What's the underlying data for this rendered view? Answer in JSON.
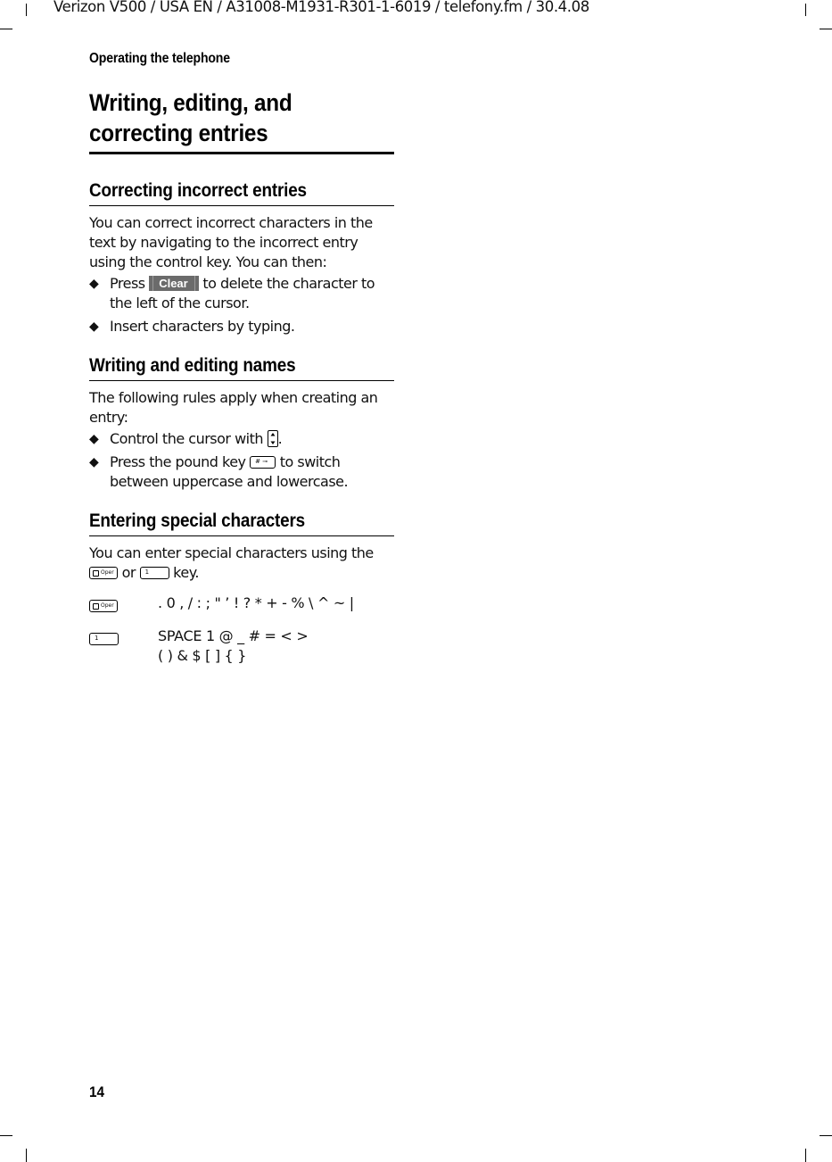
{
  "print_header": "Verizon V500 / USA EN / A31008-M1931-R301-1-6019 / telefony.fm / 30.4.08",
  "running_head": "Operating the telephone",
  "title": "Writing, editing, and correcting entries",
  "sections": [
    {
      "heading": "Correcting incorrect entries",
      "intro": "You can correct incorrect characters in the text by navigating to the incorrect entry using the control key. You can then:",
      "bullets": [
        {
          "before": "Press",
          "key": "Clear",
          "after": "to delete the character to the left of the cursor."
        },
        {
          "text": "Insert characters by typing."
        }
      ]
    },
    {
      "heading": "Writing and editing names",
      "intro": "The following rules apply when creating an entry:",
      "bullets": [
        {
          "before": "Control the cursor with",
          "key_icon": "up-down-nav-key-icon",
          "after": "."
        },
        {
          "before": "Press the pound key",
          "key_icon": "pound-key-icon",
          "key_label": "#  ⊸",
          "after": "to switch between uppercase and lowercase."
        }
      ]
    },
    {
      "heading": "Entering special characters",
      "intro_before": "You can enter special characters using the",
      "intro_or": "or",
      "intro_after": "key.",
      "keys": {
        "zero_label": "Oper",
        "one_label": "1"
      },
      "table": [
        {
          "key": "0 Oper",
          "chars_line1": ". 0 , / : ; \" ’ ! ? * + - % \\ ^ ~ |"
        },
        {
          "key": "1",
          "chars_line1": "SPACE 1 @ _ # = < >",
          "chars_line2": "( ) & $ [ ] { }"
        }
      ]
    }
  ],
  "bullet_glyph": "◆",
  "page_number": "14"
}
